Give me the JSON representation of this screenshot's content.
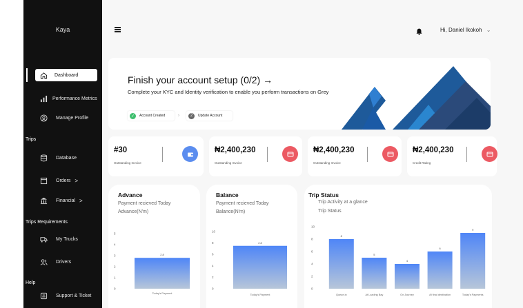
{
  "brand": "Kaya",
  "sidebar": {
    "items": [
      {
        "label": "Dashboard",
        "icon": "home-icon"
      },
      {
        "label": "Performance Metrics",
        "icon": "bar-chart-icon"
      },
      {
        "label": "Manage Profile",
        "icon": "user-circle-icon"
      }
    ],
    "section_trips": "Trips",
    "trips_items": [
      {
        "label": "Database",
        "icon": "database-icon"
      },
      {
        "label": "Orders",
        "icon": "inbox-icon",
        "chevron": ">"
      },
      {
        "label": "Financial",
        "icon": "bank-icon",
        "chevron": ">"
      }
    ],
    "section_requirements": "Trips Requirements",
    "requirement_items": [
      {
        "label": "My Trucks",
        "icon": "truck-icon"
      },
      {
        "label": "Drivers",
        "icon": "users-icon"
      }
    ],
    "section_help": "Help",
    "help_items": [
      {
        "label": "Support & Ticket",
        "icon": "support-icon"
      }
    ]
  },
  "header": {
    "user_greeting": "Hi, Daniel Ikokoh",
    "chevron": "⌄"
  },
  "setup": {
    "title": "Finish your account setup (0/2) →",
    "description": "Complete your KYC and Identity verification to enable you perform transactions on Grey",
    "step1": "Account Created",
    "step1_mark": "✓",
    "step_sep": "›",
    "step2": "Update Account",
    "step2_num": "2"
  },
  "stats": [
    {
      "value": "#30",
      "label": "Outstanding Invoice",
      "color": "#5b8def"
    },
    {
      "value": "₦2,400,230",
      "label": "Outstanding Invoice",
      "color": "#ec5a63"
    },
    {
      "value": "₦2,400,230",
      "label": "Outstanding Invoice",
      "color": "#ec5a63"
    },
    {
      "value": "₦2,400,230",
      "label": "Credit Rating",
      "color": "#ec5a63"
    }
  ],
  "charts": {
    "advance": {
      "title": "Advance",
      "subtitle": "Payment recieved Today",
      "unit": "Advance(N'm)"
    },
    "balance": {
      "title": "Balance",
      "subtitle": "Payment recieved Today",
      "unit": "Balance(N'm)"
    },
    "trip": {
      "title": "Trip Status",
      "subtitle": "Trip Activity at a glance",
      "unit": "Trip Status"
    }
  },
  "chart_data": [
    {
      "type": "bar",
      "categories": [
        "Today's Payment"
      ],
      "values": [
        2.8
      ],
      "data_labels": [
        "2.8"
      ],
      "yticks": [
        0,
        1,
        2,
        3,
        4,
        5
      ],
      "ylim": [
        0,
        5
      ],
      "grid": false,
      "bar_gradient": [
        "#4f86f7",
        "#b7c6d9"
      ]
    },
    {
      "type": "bar",
      "categories": [
        "Today's Payment"
      ],
      "values": [
        7.5
      ],
      "data_labels": [
        "2.8"
      ],
      "yticks": [
        0,
        2,
        4,
        6,
        8,
        10
      ],
      "ylim": [
        0,
        10
      ],
      "grid": false,
      "bar_gradient": [
        "#4f86f7",
        "#b7c6d9"
      ]
    },
    {
      "type": "bar",
      "categories": [
        "Queue-in",
        "At Loading Bay",
        "On Journey",
        "At final destination",
        "Today's Payments"
      ],
      "values": [
        8,
        5,
        4,
        6,
        9
      ],
      "yticks": [
        0,
        2,
        4,
        6,
        8,
        10
      ],
      "ylim": [
        0,
        10
      ],
      "grid": false,
      "bar_gradient": [
        "#4f86f7",
        "#b7c6d9"
      ]
    }
  ]
}
